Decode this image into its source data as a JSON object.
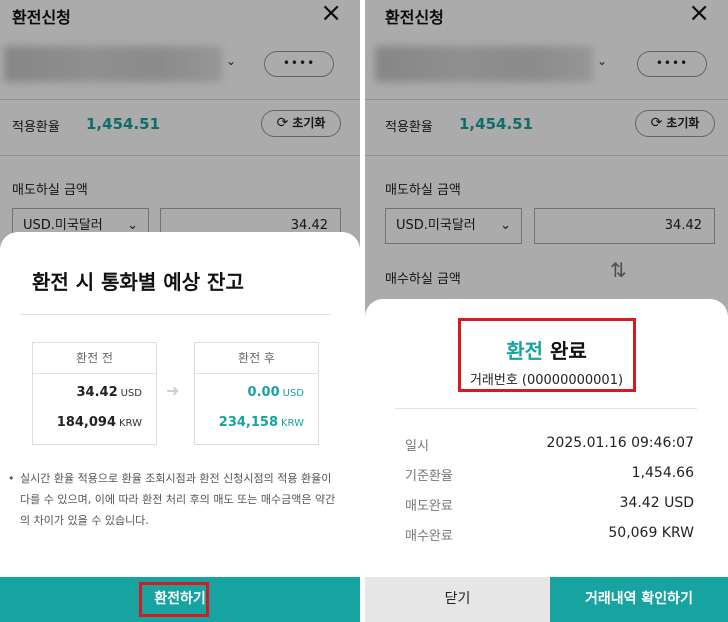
{
  "left": {
    "screen_title": "환전신청",
    "close_icon": "×",
    "more_button_label": "••••",
    "rate_label": "적용환율",
    "rate_value": "1,454.51",
    "reset_label": "초기화",
    "sell_amount_label": "매도하실 금액",
    "currency_select": "USD.미국달러",
    "amount_value": "34.42",
    "sheet": {
      "title": "환전 시 통화별 예상 잔고",
      "before": {
        "header": "환전 전",
        "row1_amount": "34.42",
        "row1_unit": "USD",
        "row2_amount": "184,094",
        "row2_unit": "KRW"
      },
      "after": {
        "header": "환전 후",
        "row1_amount": "0.00",
        "row1_unit": "USD",
        "row2_amount": "234,158",
        "row2_unit": "KRW"
      },
      "note": "실시간 환율 적용으로 환율 조회시점과 환전 신청시점의 적용 환율이 다를 수 있으며, 이에 따라 환전 처리 후의 매도 또는 매수금액은 약간의 차이가 있을 수 있습니다.",
      "note_bullet": "•",
      "confirm_button": "환전하기"
    }
  },
  "right": {
    "screen_title": "환전신청",
    "close_icon": "×",
    "more_button_label": "••••",
    "rate_label": "적용환율",
    "rate_value": "1,454.51",
    "reset_label": "초기화",
    "sell_amount_label": "매도하실 금액",
    "currency_select": "USD.미국달러",
    "amount_value": "34.42",
    "buy_amount_label": "매수하실 금액",
    "sheet": {
      "title_highlight": "환전",
      "title_rest": "완료",
      "transaction_no": "거래번호 (00000000001)",
      "details": [
        {
          "label": "일시",
          "value": "2025.01.16  09:46:07"
        },
        {
          "label": "기준환율",
          "value": "1,454.66"
        },
        {
          "label": "매도완료",
          "value": "34.42 USD"
        },
        {
          "label": "매수완료",
          "value": "50,069 KRW"
        }
      ],
      "close_button": "닫기",
      "history_button": "거래내역 확인하기"
    }
  },
  "colors": {
    "accent": "#17a3a0",
    "highlight_box": "#d71920"
  }
}
